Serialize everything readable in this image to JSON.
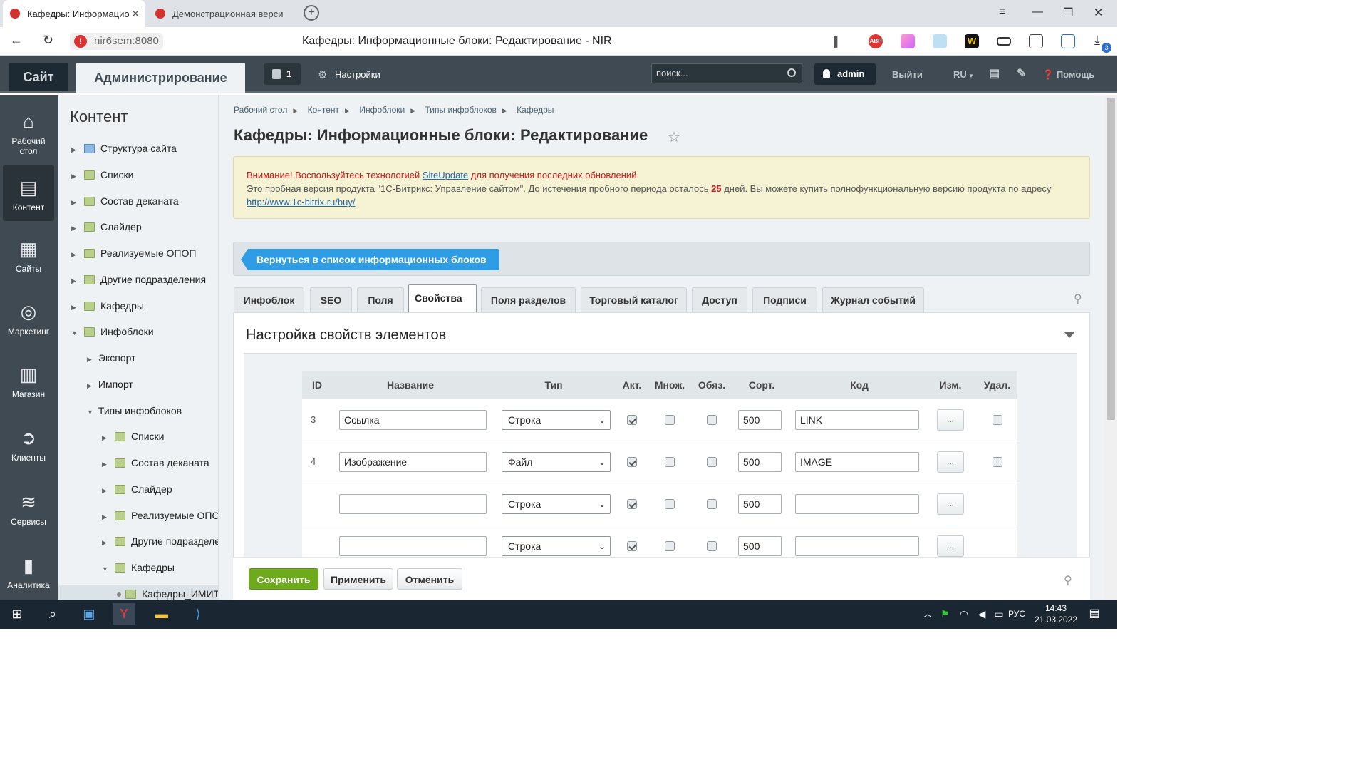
{
  "browser": {
    "tabs": [
      {
        "title": "Кафедры: Информацио"
      },
      {
        "title": "Демонстрационная верси"
      }
    ],
    "address_host": "nir6sem:8080",
    "page_title": "Кафедры: Информационные блоки: Редактирование - NIR",
    "extensions": [
      "bookmark-icon",
      "adblock-icon",
      "gradient-extension-icon",
      "bird-extension-icon",
      "w-extension-icon",
      "battery-extension-icon",
      "translate-extension-icon",
      "screenshot-extension-icon",
      "download-icon"
    ],
    "download_badge": "3",
    "colors": {
      "accent": "#d3312e"
    }
  },
  "admin_bar": {
    "site_label": "Сайт",
    "admin_label": "Администрирование",
    "notifications_count": "1",
    "settings_label": "Настройки",
    "search_placeholder": "поиск...",
    "user": "admin",
    "logout": "Выйти",
    "lang": "RU",
    "help": "Помощь"
  },
  "left_menu": [
    {
      "label": "Рабочий стол",
      "icon": "home-icon"
    },
    {
      "label": "Контент",
      "icon": "document-icon",
      "active": true
    },
    {
      "label": "Сайты",
      "icon": "calendar-24-icon"
    },
    {
      "label": "Маркетинг",
      "icon": "target-icon"
    },
    {
      "label": "Магазин",
      "icon": "basket-icon"
    },
    {
      "label": "Клиенты",
      "icon": "arrow-circle-icon"
    },
    {
      "label": "Сервисы",
      "icon": "layers-icon"
    },
    {
      "label": "Аналитика",
      "icon": "bar-chart-icon"
    }
  ],
  "tree": {
    "title": "Контент",
    "items": [
      {
        "label": "Структура сайта"
      },
      {
        "label": "Списки"
      },
      {
        "label": "Состав деканата"
      },
      {
        "label": "Слайдер"
      },
      {
        "label": "Реализуемые ОПОП"
      },
      {
        "label": "Другие подразделения"
      },
      {
        "label": "Кафедры"
      },
      {
        "label": "Инфоблоки"
      },
      {
        "label": "Экспорт"
      },
      {
        "label": "Импорт"
      },
      {
        "label": "Типы инфоблоков"
      },
      {
        "label": "Списки"
      },
      {
        "label": "Состав деканата"
      },
      {
        "label": "Слайдер"
      },
      {
        "label": "Реализуемые ОПОП"
      },
      {
        "label": "Другие подразделения"
      },
      {
        "label": "Кафедры"
      },
      {
        "label": "Кафедры_ИМИТ"
      }
    ]
  },
  "breadcrumbs": [
    "Рабочий стол",
    "Контент",
    "Инфоблоки",
    "Типы инфоблоков",
    "Кафедры"
  ],
  "heading": "Кафедры: Информационные блоки: Редактирование",
  "notice": {
    "warning_prefix": "Внимание! Воспользуйтесь технологией ",
    "warning_link": "SiteUpdate",
    "warning_suffix": " для получения последних обновлений.",
    "trial_text": "Это пробная версия продукта \"1С-Битрикс: Управление сайтом\". До истечения пробного периода осталось ",
    "days": "25",
    "trial_text2": " дней. Вы можете купить полнофункциональную версию продукта по адресу ",
    "buy_link": "http://www.1c-bitrix.ru/buy/"
  },
  "back_button": "Вернуться в список информационных блоков",
  "tabs": [
    "Инфоблок",
    "SEO",
    "Поля",
    "Свойства",
    "Поля разделов",
    "Торговый каталог",
    "Доступ",
    "Подписи",
    "Журнал событий"
  ],
  "active_tab": "Свойства",
  "panel_title": "Настройка свойств элементов",
  "table": {
    "headers": [
      "ID",
      "Название",
      "Тип",
      "Акт.",
      "Множ.",
      "Обяз.",
      "Сорт.",
      "Код",
      "Изм.",
      "Удал."
    ],
    "rows": [
      {
        "id": "3",
        "name": "Ссылка",
        "type": "Строка",
        "active": true,
        "multiple": false,
        "required": false,
        "sort": "500",
        "code": "LINK",
        "edit": "...",
        "deletable": true
      },
      {
        "id": "4",
        "name": "Изображение",
        "type": "Файл",
        "active": true,
        "multiple": false,
        "required": false,
        "sort": "500",
        "code": "IMAGE",
        "edit": "...",
        "deletable": true
      },
      {
        "id": "",
        "name": "",
        "type": "Строка",
        "active": true,
        "multiple": false,
        "required": false,
        "sort": "500",
        "code": "",
        "edit": "...",
        "deletable": false
      },
      {
        "id": "",
        "name": "",
        "type": "Строка",
        "active": true,
        "multiple": false,
        "required": false,
        "sort": "500",
        "code": "",
        "edit": "...",
        "deletable": false
      }
    ]
  },
  "buttons": {
    "save": "Сохранить",
    "apply": "Применить",
    "cancel": "Отменить"
  },
  "taskbar": {
    "lang": "РУС",
    "time": "14:43",
    "date": "21.03.2022"
  }
}
